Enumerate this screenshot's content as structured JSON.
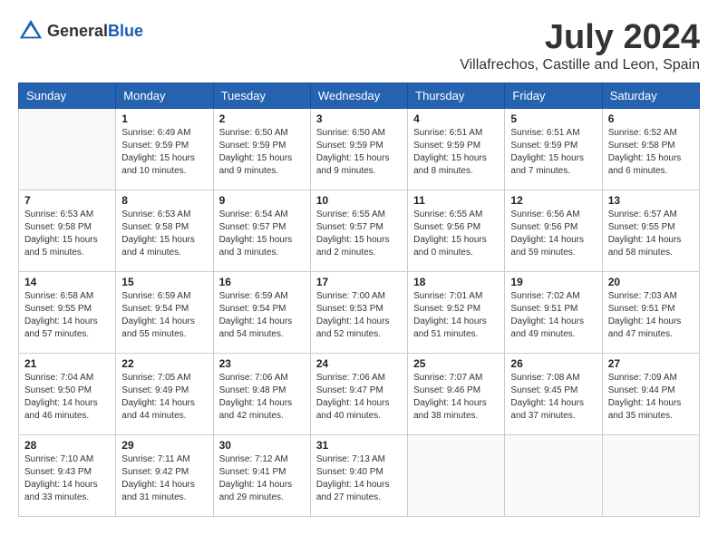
{
  "header": {
    "logo_general": "General",
    "logo_blue": "Blue",
    "month_year": "July 2024",
    "location": "Villafrechos, Castille and Leon, Spain"
  },
  "days_of_week": [
    "Sunday",
    "Monday",
    "Tuesday",
    "Wednesday",
    "Thursday",
    "Friday",
    "Saturday"
  ],
  "weeks": [
    [
      {
        "day": "",
        "info": ""
      },
      {
        "day": "1",
        "info": "Sunrise: 6:49 AM\nSunset: 9:59 PM\nDaylight: 15 hours\nand 10 minutes."
      },
      {
        "day": "2",
        "info": "Sunrise: 6:50 AM\nSunset: 9:59 PM\nDaylight: 15 hours\nand 9 minutes."
      },
      {
        "day": "3",
        "info": "Sunrise: 6:50 AM\nSunset: 9:59 PM\nDaylight: 15 hours\nand 9 minutes."
      },
      {
        "day": "4",
        "info": "Sunrise: 6:51 AM\nSunset: 9:59 PM\nDaylight: 15 hours\nand 8 minutes."
      },
      {
        "day": "5",
        "info": "Sunrise: 6:51 AM\nSunset: 9:59 PM\nDaylight: 15 hours\nand 7 minutes."
      },
      {
        "day": "6",
        "info": "Sunrise: 6:52 AM\nSunset: 9:58 PM\nDaylight: 15 hours\nand 6 minutes."
      }
    ],
    [
      {
        "day": "7",
        "info": "Sunrise: 6:53 AM\nSunset: 9:58 PM\nDaylight: 15 hours\nand 5 minutes."
      },
      {
        "day": "8",
        "info": "Sunrise: 6:53 AM\nSunset: 9:58 PM\nDaylight: 15 hours\nand 4 minutes."
      },
      {
        "day": "9",
        "info": "Sunrise: 6:54 AM\nSunset: 9:57 PM\nDaylight: 15 hours\nand 3 minutes."
      },
      {
        "day": "10",
        "info": "Sunrise: 6:55 AM\nSunset: 9:57 PM\nDaylight: 15 hours\nand 2 minutes."
      },
      {
        "day": "11",
        "info": "Sunrise: 6:55 AM\nSunset: 9:56 PM\nDaylight: 15 hours\nand 0 minutes."
      },
      {
        "day": "12",
        "info": "Sunrise: 6:56 AM\nSunset: 9:56 PM\nDaylight: 14 hours\nand 59 minutes."
      },
      {
        "day": "13",
        "info": "Sunrise: 6:57 AM\nSunset: 9:55 PM\nDaylight: 14 hours\nand 58 minutes."
      }
    ],
    [
      {
        "day": "14",
        "info": "Sunrise: 6:58 AM\nSunset: 9:55 PM\nDaylight: 14 hours\nand 57 minutes."
      },
      {
        "day": "15",
        "info": "Sunrise: 6:59 AM\nSunset: 9:54 PM\nDaylight: 14 hours\nand 55 minutes."
      },
      {
        "day": "16",
        "info": "Sunrise: 6:59 AM\nSunset: 9:54 PM\nDaylight: 14 hours\nand 54 minutes."
      },
      {
        "day": "17",
        "info": "Sunrise: 7:00 AM\nSunset: 9:53 PM\nDaylight: 14 hours\nand 52 minutes."
      },
      {
        "day": "18",
        "info": "Sunrise: 7:01 AM\nSunset: 9:52 PM\nDaylight: 14 hours\nand 51 minutes."
      },
      {
        "day": "19",
        "info": "Sunrise: 7:02 AM\nSunset: 9:51 PM\nDaylight: 14 hours\nand 49 minutes."
      },
      {
        "day": "20",
        "info": "Sunrise: 7:03 AM\nSunset: 9:51 PM\nDaylight: 14 hours\nand 47 minutes."
      }
    ],
    [
      {
        "day": "21",
        "info": "Sunrise: 7:04 AM\nSunset: 9:50 PM\nDaylight: 14 hours\nand 46 minutes."
      },
      {
        "day": "22",
        "info": "Sunrise: 7:05 AM\nSunset: 9:49 PM\nDaylight: 14 hours\nand 44 minutes."
      },
      {
        "day": "23",
        "info": "Sunrise: 7:06 AM\nSunset: 9:48 PM\nDaylight: 14 hours\nand 42 minutes."
      },
      {
        "day": "24",
        "info": "Sunrise: 7:06 AM\nSunset: 9:47 PM\nDaylight: 14 hours\nand 40 minutes."
      },
      {
        "day": "25",
        "info": "Sunrise: 7:07 AM\nSunset: 9:46 PM\nDaylight: 14 hours\nand 38 minutes."
      },
      {
        "day": "26",
        "info": "Sunrise: 7:08 AM\nSunset: 9:45 PM\nDaylight: 14 hours\nand 37 minutes."
      },
      {
        "day": "27",
        "info": "Sunrise: 7:09 AM\nSunset: 9:44 PM\nDaylight: 14 hours\nand 35 minutes."
      }
    ],
    [
      {
        "day": "28",
        "info": "Sunrise: 7:10 AM\nSunset: 9:43 PM\nDaylight: 14 hours\nand 33 minutes."
      },
      {
        "day": "29",
        "info": "Sunrise: 7:11 AM\nSunset: 9:42 PM\nDaylight: 14 hours\nand 31 minutes."
      },
      {
        "day": "30",
        "info": "Sunrise: 7:12 AM\nSunset: 9:41 PM\nDaylight: 14 hours\nand 29 minutes."
      },
      {
        "day": "31",
        "info": "Sunrise: 7:13 AM\nSunset: 9:40 PM\nDaylight: 14 hours\nand 27 minutes."
      },
      {
        "day": "",
        "info": ""
      },
      {
        "day": "",
        "info": ""
      },
      {
        "day": "",
        "info": ""
      }
    ]
  ]
}
